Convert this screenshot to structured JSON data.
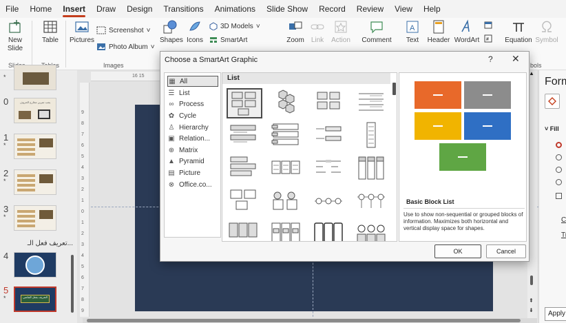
{
  "menu": [
    "File",
    "Home",
    "Insert",
    "Draw",
    "Design",
    "Transitions",
    "Animations",
    "Slide Show",
    "Record",
    "Review",
    "View",
    "Help"
  ],
  "active_tab": "Insert",
  "ribbon": {
    "new_slide": "New Slide",
    "table": "Table",
    "pictures": "Pictures",
    "screenshot": "Screenshot",
    "photo_album": "Photo Album",
    "shapes": "Shapes",
    "icons": "Icons",
    "models_3d": "3D Models",
    "smartart": "SmartArt",
    "zoom": "Zoom",
    "link": "Link",
    "action": "Action",
    "comment": "Comment",
    "text": "Text",
    "header": "Header",
    "wordart": "WordArt",
    "equation": "Equation",
    "symbol": "Symbol",
    "group_slides": "Slides",
    "group_tables": "Tables",
    "group_images": "Images",
    "group_symbols": "bols"
  },
  "slides": [
    {
      "num": "0",
      "star": "*"
    },
    {
      "num": "1",
      "star": "*"
    },
    {
      "num": "2",
      "star": "*"
    },
    {
      "num": "3",
      "star": "*"
    },
    {
      "num": "4",
      "star": ""
    },
    {
      "num": "5",
      "star": "*"
    }
  ],
  "thumb_texts": {
    "t0": "يجب تمرين مخارج الحروف",
    "t5": "التعريف بفعل الماضي"
  },
  "section_label": "تعريف فعل الـ...",
  "ruler_top": "16 15",
  "ruler_left": [
    "9",
    "8",
    "7",
    "6",
    "5",
    "4",
    "3",
    "2",
    "1",
    "0",
    "1",
    "2",
    "3",
    "4",
    "5",
    "6",
    "7",
    "8",
    "9"
  ],
  "dialog": {
    "title": "Choose a SmartArt Graphic",
    "help": "?",
    "close": "✕",
    "categories": [
      {
        "label": "All",
        "glyph": "▦"
      },
      {
        "label": "List",
        "glyph": "☰"
      },
      {
        "label": "Process",
        "glyph": "∞"
      },
      {
        "label": "Cycle",
        "glyph": "✿"
      },
      {
        "label": "Hierarchy",
        "glyph": "♙"
      },
      {
        "label": "Relation...",
        "glyph": "▣"
      },
      {
        "label": "Matrix",
        "glyph": "⊕"
      },
      {
        "label": "Pyramid",
        "glyph": "▲"
      },
      {
        "label": "Picture",
        "glyph": "▤"
      },
      {
        "label": "Office.co...",
        "glyph": "⊗"
      }
    ],
    "gallery_header": "List",
    "preview_name": "Basic Block List",
    "preview_desc": "Use to show non-sequential or grouped blocks of information. Maximizes both horizontal and vertical display space for shapes.",
    "ok": "OK",
    "cancel": "Cancel"
  },
  "format_pane": {
    "title": "Form",
    "fill": "Fill",
    "link1": "Co",
    "link2": "Tr",
    "apply": "Apply"
  },
  "colors": {
    "accent": "#c43e1c",
    "orange": "#e8692a",
    "gray": "#8c8c8c",
    "gold": "#f1b400",
    "blue": "#2f6fc4",
    "green": "#5fa644",
    "slide_bg": "#2a3a55"
  }
}
